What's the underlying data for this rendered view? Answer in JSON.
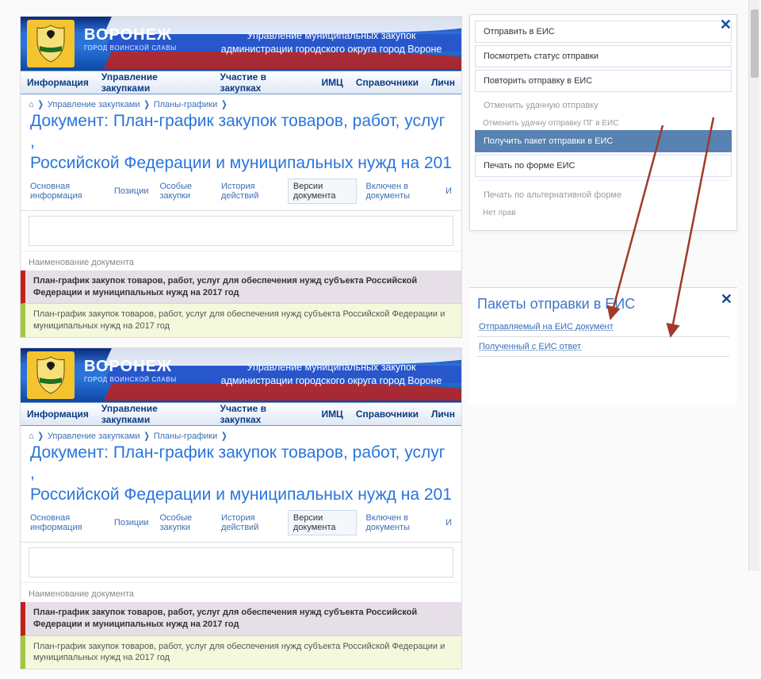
{
  "brand": {
    "title": "ВОРОНЕЖ",
    "subtitle": "ГОРОД ВОИНСКОЙ СЛАВЫ"
  },
  "banner": {
    "line1": "Управление муниципальных закупок",
    "line2": "администрации городского округа город Вороне"
  },
  "menu": {
    "m0": "Информация",
    "m1": "Управление закупками",
    "m2": "Участие в закупках",
    "m3": "ИМЦ",
    "m4": "Справочники",
    "m5": "Личн"
  },
  "crumbs": {
    "home": "⌂",
    "c1": "Управление закупками",
    "c2": "Планы-графики"
  },
  "heading": "Документ: План-график закупок товаров, работ, услуг для ... Российской Федерации и муниципальных нужд на 201",
  "heading_l1": "Документ: План-график закупок товаров, работ, услуг ,",
  "heading_l2": "Российской Федерации и муниципальных нужд на 201",
  "tabs": {
    "t0": "Основная информация",
    "t1": "Позиции",
    "t2": "Особые закупки",
    "t3": "История действий",
    "t4": "Версии документа",
    "t5": "Включен в документы",
    "t6": "И"
  },
  "grid_header": "Наименование документа",
  "rows": {
    "r0": "План-график закупок товаров, работ, услуг для обеспечения нужд субъекта Российской Федерации и муниципальных нужд на 2017 год",
    "r1": "План-график закупок товаров, работ, услуг для обеспечения нужд субъекта Российской Федерации и муниципальных нужд на 2017 год"
  },
  "dropdown": {
    "i0": "Отправить в ЕИС",
    "i1": "Посмотреть статус отправки",
    "i2": "Повторить отправку в ЕИС",
    "i3": "Отменить удачную отправку",
    "i3h": "Отменить удачну отправку ПГ в ЕИС",
    "i4": "Получить пакет отправки в ЕИС",
    "i5": "Печать по форме ЕИС",
    "i6": "Печать по альтернативной форме",
    "i6h": "Нет прав"
  },
  "packets": {
    "title": "Пакеты отправки в ЕИС",
    "l0": "Отправляемый на ЕИС документ",
    "l1": "Полученный с ЕИС ответ"
  }
}
